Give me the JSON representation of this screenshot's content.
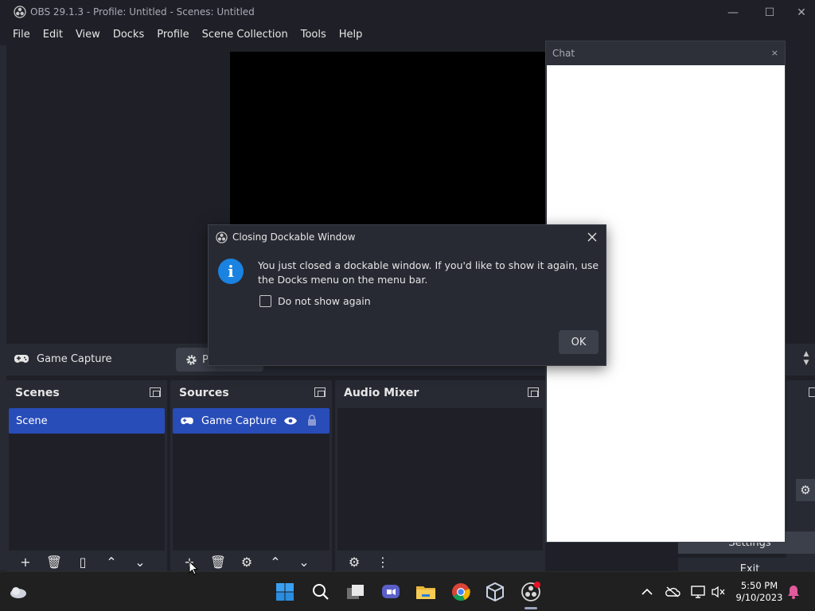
{
  "window": {
    "title": "OBS 29.1.3 - Profile: Untitled - Scenes: Untitled",
    "minimize": "—",
    "maximize": "☐",
    "close": "✕"
  },
  "menu": [
    "File",
    "Edit",
    "View",
    "Docks",
    "Profile",
    "Scene Collection",
    "Tools",
    "Help"
  ],
  "source_toolbar": {
    "source_name": "Game Capture",
    "properties_label": "Pr"
  },
  "docks": {
    "scenes": {
      "title": "Scenes",
      "items": [
        "Scene"
      ]
    },
    "sources": {
      "title": "Sources",
      "items": [
        "Game Capture"
      ]
    },
    "audio_mixer": {
      "title": "Audio Mixer"
    }
  },
  "chat": {
    "title": "Chat",
    "close": "×"
  },
  "controls": {
    "settings": "Settings",
    "exit": "Exit"
  },
  "dialog": {
    "title": "Closing Dockable Window",
    "message": "You just closed a dockable window. If you'd like to show it again, use the Docks menu on the menu bar.",
    "checkbox_label": "Do not show again",
    "ok": "OK"
  },
  "taskbar": {
    "time": "5:50 PM",
    "date": "9/10/2023"
  },
  "colors": {
    "accent_selection": "#284cb8",
    "info_icon": "#1a82e0",
    "background": "#1f2027",
    "dock": "#272a33"
  }
}
